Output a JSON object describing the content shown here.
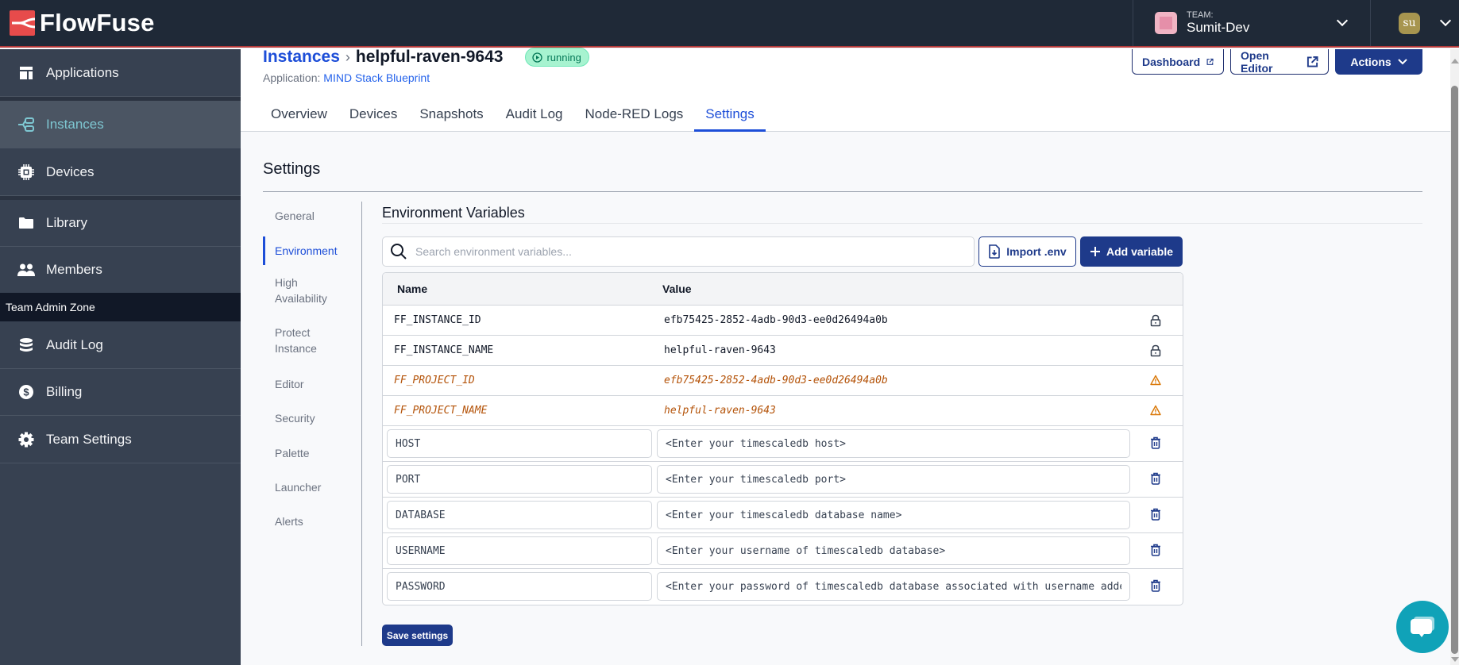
{
  "app": {
    "brand": "FlowFuse",
    "team_label": "TEAM:",
    "team_name": "Sumit-Dev",
    "user_initials": "su"
  },
  "sidebar": {
    "items": [
      {
        "label": "Applications",
        "icon": "applications-icon",
        "active": false
      },
      {
        "label": "Instances",
        "icon": "instances-icon",
        "active": true
      },
      {
        "label": "Devices",
        "icon": "devices-icon",
        "active": false
      },
      {
        "label": "Library",
        "icon": "folder-icon",
        "active": false
      },
      {
        "label": "Members",
        "icon": "users-icon",
        "active": false
      }
    ],
    "zone_label": "Team Admin Zone",
    "admin_items": [
      {
        "label": "Audit Log",
        "icon": "database-icon"
      },
      {
        "label": "Billing",
        "icon": "dollar-icon"
      },
      {
        "label": "Team Settings",
        "icon": "gear-icon"
      }
    ]
  },
  "header": {
    "breadcrumb_parent": "Instances",
    "breadcrumb_current": "helpful-raven-9643",
    "status": "running",
    "application_label": "Application:",
    "application_name": "MIND Stack Blueprint",
    "buttons": {
      "dashboard": "Dashboard",
      "open_editor": "Open Editor",
      "actions": "Actions"
    },
    "tabs": [
      {
        "label": "Overview",
        "active": false
      },
      {
        "label": "Devices",
        "active": false
      },
      {
        "label": "Snapshots",
        "active": false
      },
      {
        "label": "Audit Log",
        "active": false
      },
      {
        "label": "Node-RED Logs",
        "active": false
      },
      {
        "label": "Settings",
        "active": true
      }
    ]
  },
  "settings": {
    "title": "Settings",
    "subnav": [
      {
        "label": "General",
        "active": false
      },
      {
        "label": "Environment",
        "active": true
      },
      {
        "label": "High Availability",
        "active": false
      },
      {
        "label": "Protect Instance",
        "active": false
      },
      {
        "label": "Editor",
        "active": false
      },
      {
        "label": "Security",
        "active": false
      },
      {
        "label": "Palette",
        "active": false
      },
      {
        "label": "Launcher",
        "active": false
      },
      {
        "label": "Alerts",
        "active": false
      }
    ],
    "env": {
      "title": "Environment Variables",
      "search_placeholder": "Search environment variables...",
      "import_label": "Import .env",
      "add_label": "Add variable",
      "columns": {
        "name": "Name",
        "value": "Value"
      },
      "readonly_rows": [
        {
          "name": "FF_INSTANCE_ID",
          "value": "efb75425-2852-4adb-90d3-ee0d26494a0b",
          "icon": "lock-icon",
          "deprecated": false
        },
        {
          "name": "FF_INSTANCE_NAME",
          "value": "helpful-raven-9643",
          "icon": "lock-icon",
          "deprecated": false
        },
        {
          "name": "FF_PROJECT_ID",
          "value": "efb75425-2852-4adb-90d3-ee0d26494a0b",
          "icon": "warning-icon",
          "deprecated": true
        },
        {
          "name": "FF_PROJECT_NAME",
          "value": "helpful-raven-9643",
          "icon": "warning-icon",
          "deprecated": true
        }
      ],
      "editable_rows": [
        {
          "name": "HOST",
          "value": "<Enter your timescaledb host>"
        },
        {
          "name": "PORT",
          "value": "<Enter your timescaledb port>"
        },
        {
          "name": "DATABASE",
          "value": "<Enter your timescaledb database name>"
        },
        {
          "name": "USERNAME",
          "value": "<Enter your username of timescaledb database>"
        },
        {
          "name": "PASSWORD",
          "value": "<Enter your password of timescaledb database associated with username added"
        }
      ],
      "save_label": "Save settings"
    }
  },
  "colors": {
    "brand_red": "#e74b4b",
    "primary_blue": "#1e3a8a",
    "link_blue": "#1d4ed8",
    "sidebar_bg": "#374151",
    "topbar_bg": "#1f2937",
    "active_teal": "#7ec7d2",
    "running_green": "#a7f3d0",
    "warning_amber": "#b45309",
    "chat_teal": "#10a2b8"
  }
}
